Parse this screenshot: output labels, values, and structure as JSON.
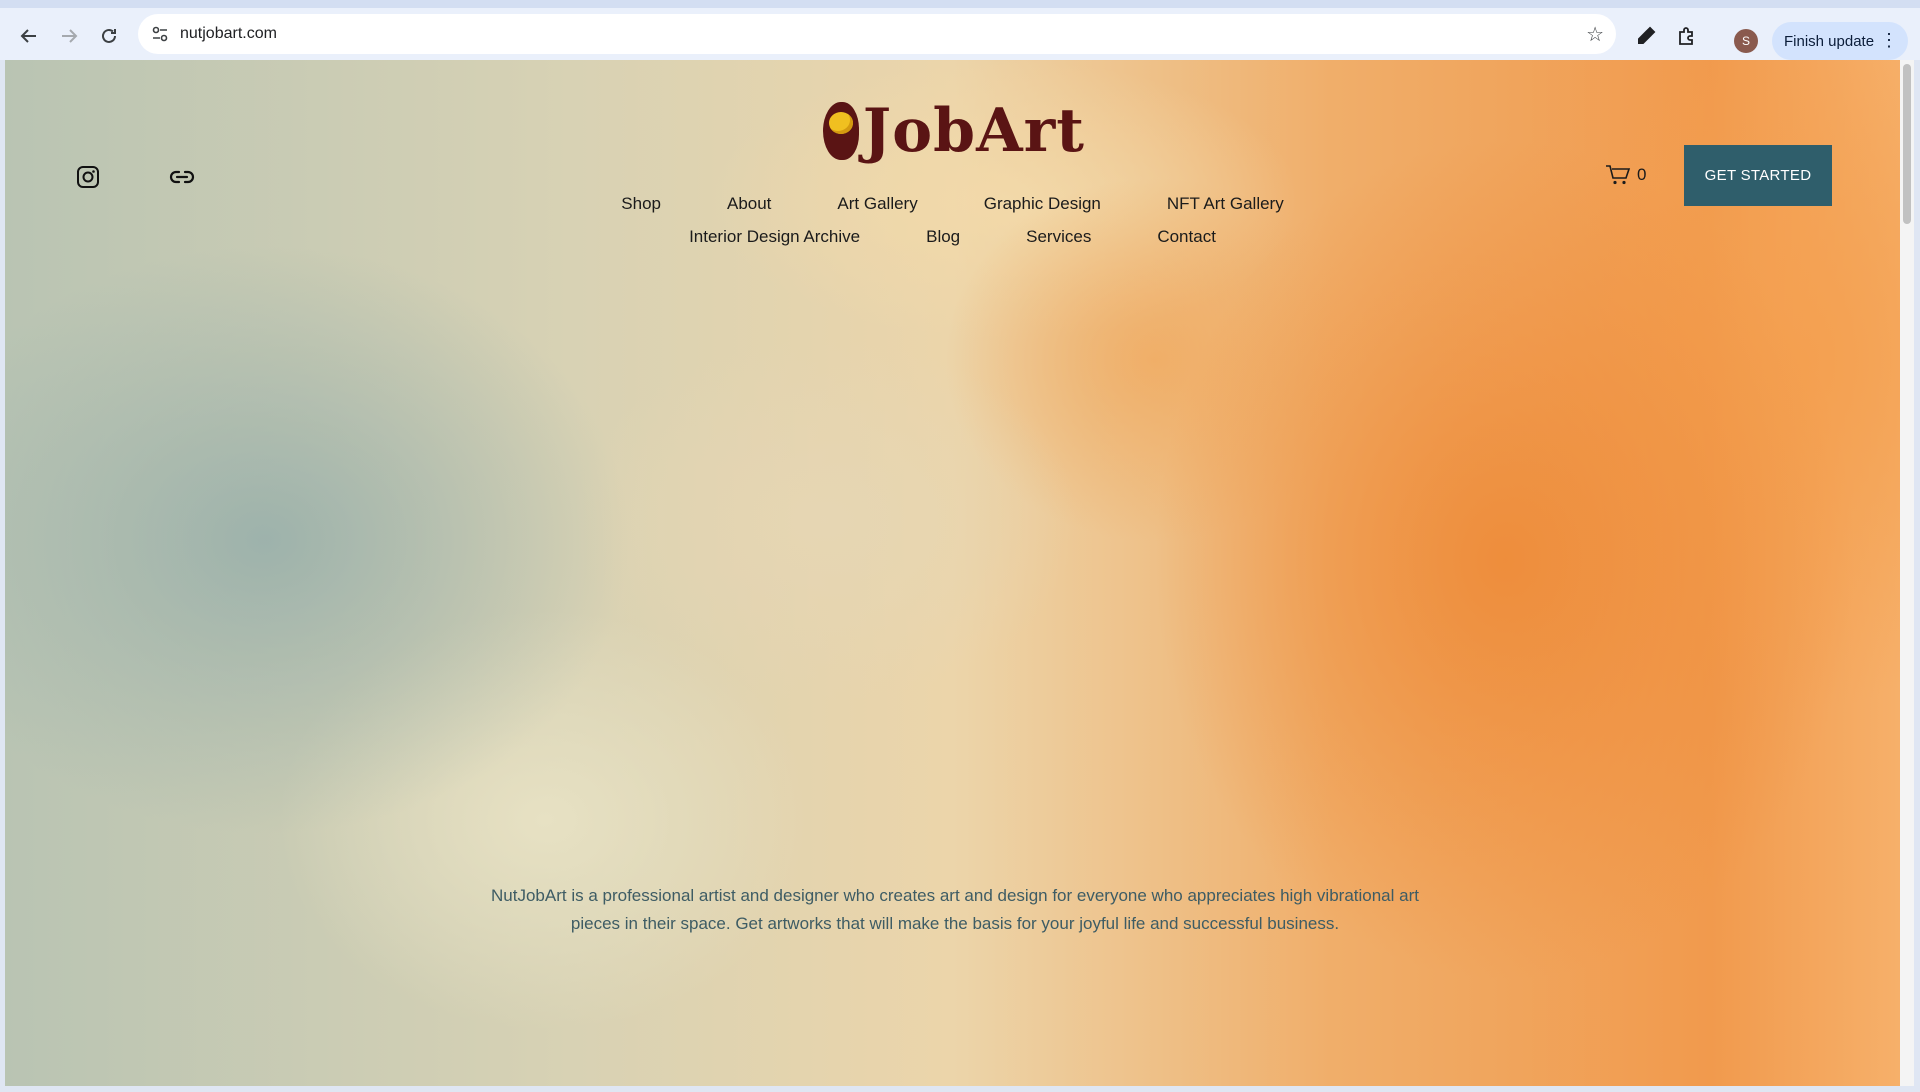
{
  "browser": {
    "url": "nutjobart.com",
    "avatar_initial": "S",
    "finish_update_label": "Finish update"
  },
  "site": {
    "logo_text": "JobArt",
    "nav_row1": [
      "Shop",
      "About",
      "Art Gallery",
      "Graphic Design",
      "NFT Art Gallery"
    ],
    "nav_row2": [
      "Interior Design Archive",
      "Blog",
      "Services",
      "Contact"
    ],
    "cart_count": "0",
    "cta_label": "GET STARTED",
    "intro_line1": "NutJobArt is a professional artist and designer who creates art and design for everyone who appreciates high vibrational art",
    "intro_line2": "pieces in their space. Get artworks that will make the basis for your joyful life and successful business."
  },
  "colors": {
    "logo": "#5a1414",
    "cta_bg": "#2f5e6b",
    "intro_text": "#3e5c64"
  }
}
